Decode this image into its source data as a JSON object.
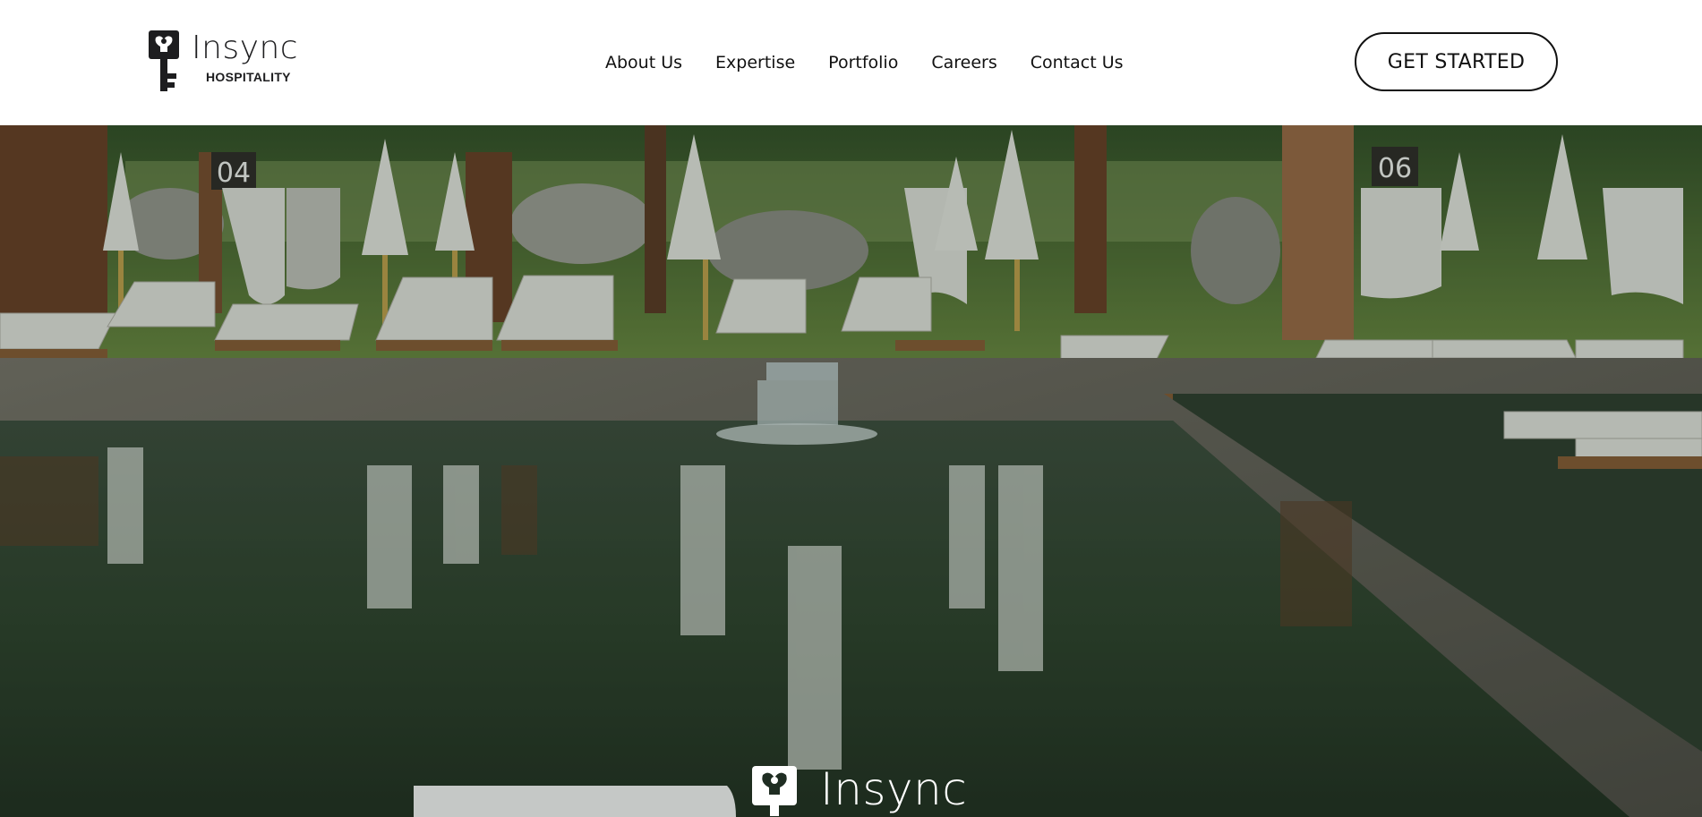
{
  "header": {
    "logo": {
      "name": "Insync",
      "subtitle": "HOSPITALITY"
    },
    "nav": [
      {
        "label": "About Us"
      },
      {
        "label": "Expertise"
      },
      {
        "label": "Portfolio"
      },
      {
        "label": "Careers"
      },
      {
        "label": "Contact Us"
      }
    ],
    "cta_label": "GET STARTED"
  },
  "hero": {
    "image": "pool-with-cabanas-and-loungers",
    "cabana_numbers": [
      "04",
      "06"
    ],
    "logo_text": "Insync"
  },
  "colors": {
    "text": "#111111",
    "background": "#ffffff",
    "hero_overlay": "#1f2d22"
  }
}
